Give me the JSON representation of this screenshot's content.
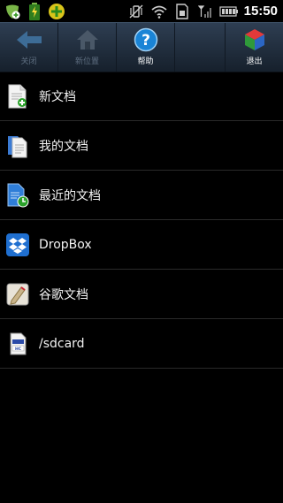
{
  "statusbar": {
    "time": "15:50"
  },
  "toolbar": {
    "back_label": "关闭",
    "home_label": "新位置",
    "help_label": "帮助",
    "exit_label": "退出"
  },
  "list": [
    {
      "label": "新文档",
      "icon": "new-document-icon"
    },
    {
      "label": "我的文档",
      "icon": "my-documents-icon"
    },
    {
      "label": "最近的文档",
      "icon": "recent-documents-icon"
    },
    {
      "label": "DropBox",
      "icon": "dropbox-icon"
    },
    {
      "label": "谷歌文档",
      "icon": "google-docs-icon"
    },
    {
      "label": "/sdcard",
      "icon": "sdcard-icon"
    }
  ]
}
